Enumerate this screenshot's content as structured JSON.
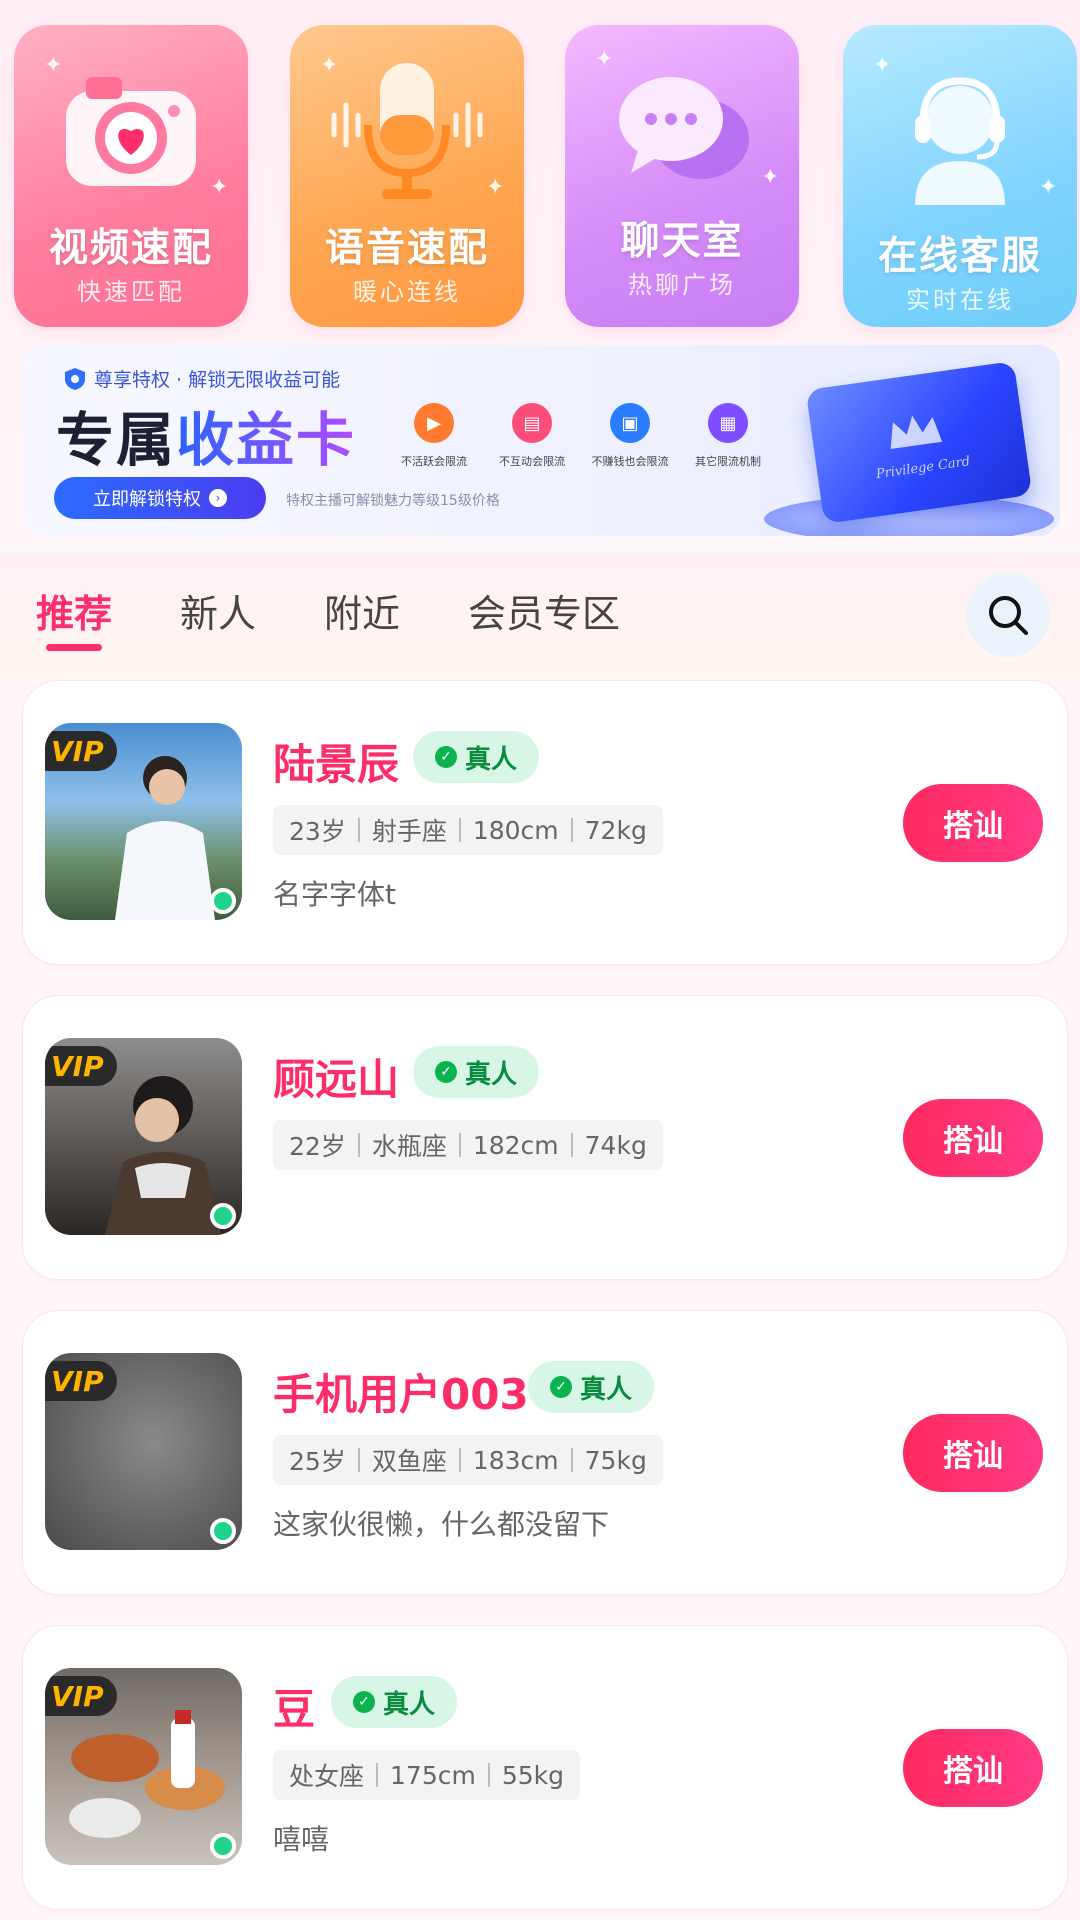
{
  "tiles": [
    {
      "title": "视频速配",
      "subtitle": "快速匹配",
      "icon": "camera-heart-icon"
    },
    {
      "title": "语音速配",
      "subtitle": "暖心连线",
      "icon": "microphone-icon"
    },
    {
      "title": "聊天室",
      "subtitle": "热聊广场",
      "icon": "chat-bubbles-icon"
    },
    {
      "title": "在线客服",
      "subtitle": "实时在线",
      "icon": "headset-agent-icon"
    }
  ],
  "banner": {
    "top_text": "尊享特权 · 解锁无限收益可能",
    "title_a": "专属",
    "title_b": "收益卡",
    "button": "立即解锁特权",
    "note": "特权主播可解锁魅力等级15级价格",
    "features": [
      "不活跃会限流",
      "不互动会限流",
      "不赚钱也会限流",
      "其它限流机制"
    ],
    "card_text": "Privilege Card"
  },
  "tabs": [
    "推荐",
    "新人",
    "附近",
    "会员专区"
  ],
  "users": [
    {
      "name": "陆景辰",
      "badge": "真人",
      "tags": [
        "23岁",
        "射手座",
        "180cm",
        "72kg"
      ],
      "bio": "名字字体t",
      "action": "搭讪",
      "vip": "VIP"
    },
    {
      "name": "顾远山",
      "badge": "真人",
      "tags": [
        "22岁",
        "水瓶座",
        "182cm",
        "74kg"
      ],
      "bio": "",
      "action": "搭讪",
      "vip": "VIP"
    },
    {
      "name": "手机用户003",
      "badge": "真人",
      "tags": [
        "25岁",
        "双鱼座",
        "183cm",
        "75kg"
      ],
      "bio": "这家伙很懒，什么都没留下",
      "action": "搭讪",
      "vip": "VIP"
    },
    {
      "name": "豆",
      "badge": "真人",
      "tags": [
        "处女座",
        "175cm",
        "55kg"
      ],
      "bio": "嘻嘻",
      "action": "搭讪",
      "vip": "VIP"
    }
  ]
}
